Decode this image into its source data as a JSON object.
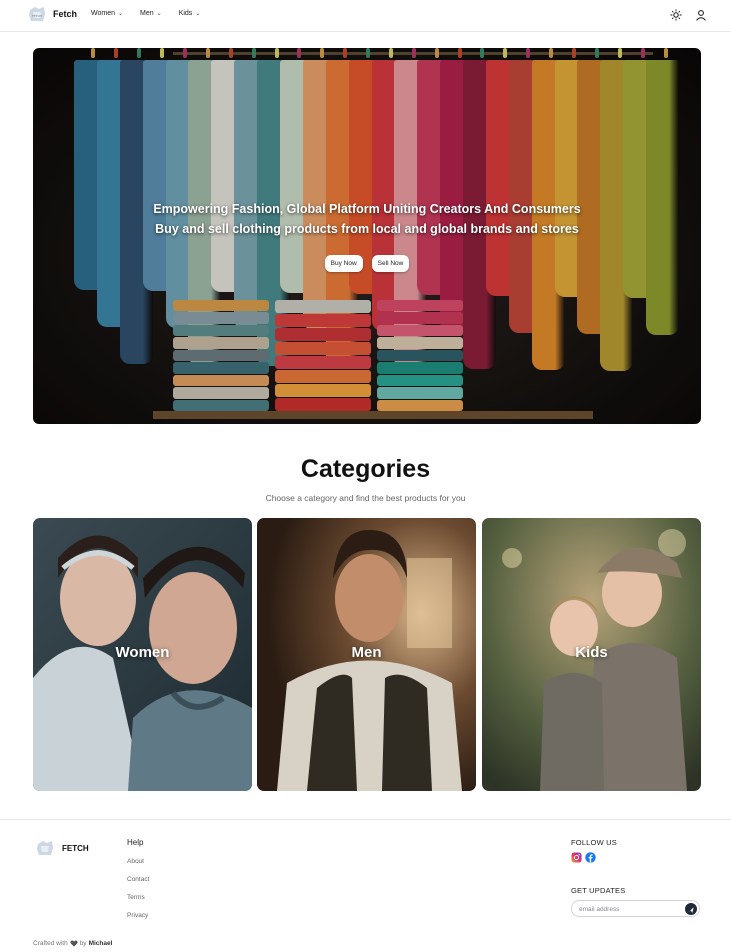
{
  "header": {
    "brand": "Fetch",
    "nav": [
      {
        "label": "Women"
      },
      {
        "label": "Men"
      },
      {
        "label": "Kids"
      }
    ],
    "icons": [
      "sun-icon",
      "user-icon"
    ]
  },
  "hero": {
    "headline": "Empowering Fashion, Global Platform Uniting Creators And Consumers",
    "subheadline": "Buy and sell clothing products from local and global brands and stores",
    "buy_label": "Buy Now",
    "sell_label": "Sell Now"
  },
  "categories": {
    "title": "Categories",
    "subtitle": "Choose a category and find the best products for you",
    "items": [
      {
        "label": "Women"
      },
      {
        "label": "Men"
      },
      {
        "label": "Kids"
      }
    ]
  },
  "footer": {
    "brand": "FETCH",
    "help_title": "Help",
    "help_links": [
      "About",
      "Contact",
      "Terms",
      "Privacy"
    ],
    "follow_title": "FOLLOW US",
    "socials": [
      "instagram-icon",
      "facebook-icon"
    ],
    "updates_title": "GET UPDATES",
    "email_placeholder": "email address",
    "crafted_prefix": "Crafted with",
    "crafted_by": "by",
    "crafted_author": "Michael"
  },
  "colors": {
    "accent": "#111111",
    "muted": "#666666",
    "border": "#e5e7eb"
  }
}
